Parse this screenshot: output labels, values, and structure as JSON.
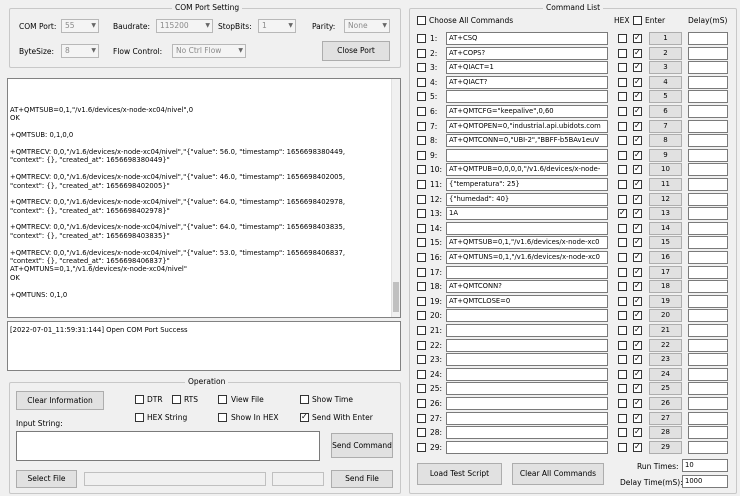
{
  "com_setting": {
    "title": "COM Port Setting",
    "com_port_label": "COM Port:",
    "com_port_value": "55",
    "baudrate_label": "Baudrate:",
    "baudrate_value": "115200",
    "stopbits_label": "StopBits:",
    "stopbits_value": "1",
    "parity_label": "Parity:",
    "parity_value": "None",
    "bytesize_label": "ByteSize:",
    "bytesize_value": "8",
    "flow_label": "Flow Control:",
    "flow_value": "No Ctrl Flow",
    "close_port_label": "Close Port"
  },
  "receive_log": [
    "AT+QMTSUB=0,1,\"/v1.6/devices/x-node-xc04/nivel\",0",
    "OK",
    "",
    "+QMTSUB: 0,1,0,0",
    "",
    "+QMTRECV: 0,0,\"/v1.6/devices/x-node-xc04/nivel\",\"{\"value\": 56.0, \"timestamp\": 1656698380449,",
    "\"context\": {}, \"created_at\": 1656698380449}\"",
    "",
    "+QMTRECV: 0,0,\"/v1.6/devices/x-node-xc04/nivel\",\"{\"value\": 46.0, \"timestamp\": 1656698402005,",
    "\"context\": {}, \"created_at\": 1656698402005}\"",
    "",
    "+QMTRECV: 0,0,\"/v1.6/devices/x-node-xc04/nivel\",\"{\"value\": 64.0, \"timestamp\": 1656698402978,",
    "\"context\": {}, \"created_at\": 1656698402978}\"",
    "",
    "+QMTRECV: 0,0,\"/v1.6/devices/x-node-xc04/nivel\",\"{\"value\": 64.0, \"timestamp\": 1656698403835,",
    "\"context\": {}, \"created_at\": 1656698403835}\"",
    "",
    "+QMTRECV: 0,0,\"/v1.6/devices/x-node-xc04/nivel\",\"{\"value\": 53.0, \"timestamp\": 1656698406837,",
    "\"context\": {}, \"created_at\": 1656698406837}\"",
    "AT+QMTUNS=0,1,\"/v1.6/devices/x-node-xc04/nivel\"",
    "OK",
    "",
    "+QMTUNS: 0,1,0"
  ],
  "status_log": "[2022-07-01_11:59:31:144] Open COM Port Success",
  "operation": {
    "title": "Operation",
    "clear_info_label": "Clear Information",
    "dtr_label": "DTR",
    "rts_label": "RTS",
    "view_file_label": "View File",
    "show_time_label": "Show Time",
    "hex_string_label": "HEX String",
    "show_in_hex_label": "Show In HEX",
    "send_with_enter_label": "Send With Enter",
    "input_string_label": "Input String:",
    "send_command_label": "Send Command",
    "select_file_label": "Select File",
    "send_file_label": "Send File"
  },
  "command_list": {
    "title": "Command List",
    "choose_all_label": "Choose All Commands",
    "hex_header": "HEX",
    "enter_header": "Enter",
    "delay_header": "Delay(mS)",
    "rows": [
      {
        "num": "1:",
        "cmd": "AT+CSQ",
        "hex": false,
        "enter": true,
        "btn": "1"
      },
      {
        "num": "2:",
        "cmd": "AT+COPS?",
        "hex": false,
        "enter": true,
        "btn": "2"
      },
      {
        "num": "3:",
        "cmd": "AT+QIACT=1",
        "hex": false,
        "enter": true,
        "btn": "3"
      },
      {
        "num": "4:",
        "cmd": "AT+QIACT?",
        "hex": false,
        "enter": true,
        "btn": "4"
      },
      {
        "num": "5:",
        "cmd": "",
        "hex": false,
        "enter": true,
        "btn": "5"
      },
      {
        "num": "6:",
        "cmd": "AT+QMTCFG=\"keepalive\",0,60",
        "hex": false,
        "enter": true,
        "btn": "6"
      },
      {
        "num": "7:",
        "cmd": "AT+QMTOPEN=0,\"industrial.api.ubidots.com",
        "hex": false,
        "enter": true,
        "btn": "7"
      },
      {
        "num": "8:",
        "cmd": "AT+QMTCONN=0,\"UBI-2\",\"BBFF-b5BAv1euV",
        "hex": false,
        "enter": true,
        "btn": "8"
      },
      {
        "num": "9:",
        "cmd": "",
        "hex": false,
        "enter": true,
        "btn": "9"
      },
      {
        "num": "10:",
        "cmd": "AT+QMTPUB=0,0,0,0,\"/v1.6/devices/x-node-",
        "hex": false,
        "enter": true,
        "btn": "10"
      },
      {
        "num": "11:",
        "cmd": "{\"temperatura\": 25}",
        "hex": false,
        "enter": true,
        "btn": "11"
      },
      {
        "num": "12:",
        "cmd": "{\"humedad\": 40}",
        "hex": false,
        "enter": true,
        "btn": "12"
      },
      {
        "num": "13:",
        "cmd": "1A",
        "hex": true,
        "enter": true,
        "btn": "13"
      },
      {
        "num": "14:",
        "cmd": "",
        "hex": false,
        "enter": true,
        "btn": "14"
      },
      {
        "num": "15:",
        "cmd": "AT+QMTSUB=0,1,\"/v1.6/devices/x-node-xc0",
        "hex": false,
        "enter": true,
        "btn": "15"
      },
      {
        "num": "16:",
        "cmd": "AT+QMTUNS=0,1,\"/v1.6/devices/x-node-xc0",
        "hex": false,
        "enter": true,
        "btn": "16"
      },
      {
        "num": "17:",
        "cmd": "",
        "hex": false,
        "enter": true,
        "btn": "17"
      },
      {
        "num": "18:",
        "cmd": "AT+QMTCONN?",
        "hex": false,
        "enter": true,
        "btn": "18"
      },
      {
        "num": "19:",
        "cmd": "AT+QMTCLOSE=0",
        "hex": false,
        "enter": true,
        "btn": "19"
      },
      {
        "num": "20:",
        "cmd": "",
        "hex": false,
        "enter": true,
        "btn": "20"
      },
      {
        "num": "21:",
        "cmd": "",
        "hex": false,
        "enter": true,
        "btn": "21"
      },
      {
        "num": "22:",
        "cmd": "",
        "hex": false,
        "enter": true,
        "btn": "22"
      },
      {
        "num": "23:",
        "cmd": "",
        "hex": false,
        "enter": true,
        "btn": "23"
      },
      {
        "num": "24:",
        "cmd": "",
        "hex": false,
        "enter": true,
        "btn": "24"
      },
      {
        "num": "25:",
        "cmd": "",
        "hex": false,
        "enter": true,
        "btn": "25"
      },
      {
        "num": "26:",
        "cmd": "",
        "hex": false,
        "enter": true,
        "btn": "26"
      },
      {
        "num": "27:",
        "cmd": "",
        "hex": false,
        "enter": true,
        "btn": "27"
      },
      {
        "num": "28:",
        "cmd": "",
        "hex": false,
        "enter": true,
        "btn": "28"
      },
      {
        "num": "29:",
        "cmd": "",
        "hex": false,
        "enter": true,
        "btn": "29"
      }
    ],
    "load_test_script_label": "Load Test Script",
    "clear_all_label": "Clear All Commands",
    "run_times_label": "Run Times:",
    "run_times_value": "10",
    "delay_time_label": "Delay Time(mS):",
    "delay_time_value": "1000"
  }
}
